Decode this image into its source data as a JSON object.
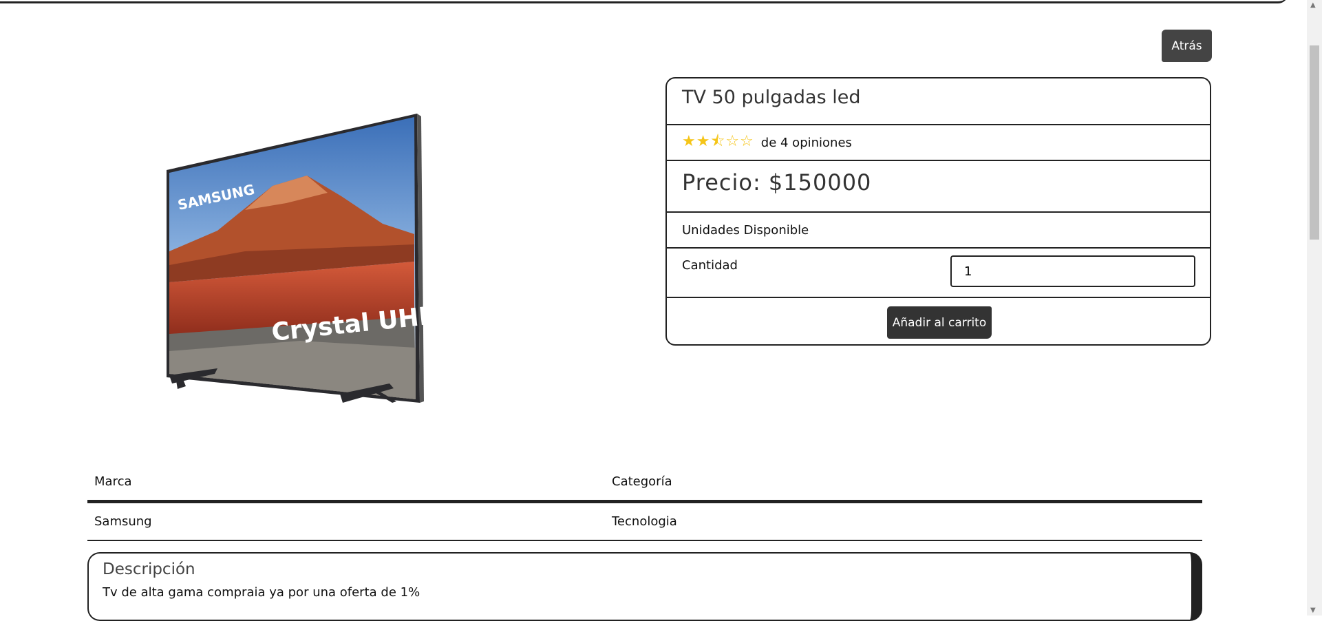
{
  "nav": {
    "back_label": "Atrás"
  },
  "product": {
    "title": "TV 50 pulgadas led",
    "rating": 2.5,
    "rating_max": 5,
    "reviews_text": "de 4 opiniones",
    "price_text": "Precio: $150000",
    "stock_label": "Unidades Disponible",
    "quantity_label": "Cantidad",
    "quantity_value": "1",
    "add_to_cart_label": "Añadir al carrito"
  },
  "details": {
    "headers": [
      "Marca",
      "Categoría"
    ],
    "values": [
      "Samsung",
      "Tecnologia"
    ]
  },
  "description": {
    "title": "Descripción",
    "text": "Tv de alta gama compraia ya por una oferta de 1%"
  },
  "image": {
    "brand_text": "SAMSUNG",
    "panel_text": "Crystal UHD"
  },
  "colors": {
    "accent_star": "#f5c518",
    "button_bg": "#333333"
  }
}
